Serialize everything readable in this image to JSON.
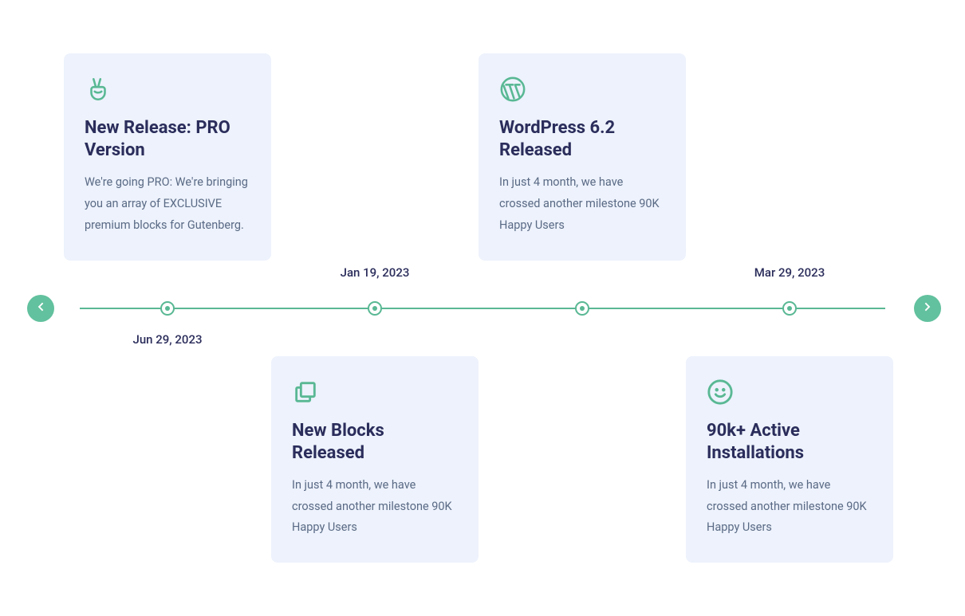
{
  "colors": {
    "accent": "#59b894",
    "arrow_bg": "#62c19e",
    "card_bg": "#edf2fc",
    "heading": "#2b2d5b",
    "body_text": "#5a6a85"
  },
  "timeline": {
    "nav_prev_label": "Previous",
    "nav_next_label": "Next",
    "items": [
      {
        "position": "top",
        "icon": "peace-hand-icon",
        "title": "New Release: PRO Version",
        "description": "We're going PRO: We're bringing you an array of EXCLUSIVE premium blocks for Gutenberg.",
        "date": "Jun 29, 2023",
        "date_side": "below"
      },
      {
        "position": "bottom",
        "icon": "copy-icon",
        "title": "New Blocks Released",
        "description": "In just 4 month, we have crossed another milestone 90K Happy Users",
        "date": "Jan 19, 2023",
        "date_side": "above"
      },
      {
        "position": "top",
        "icon": "wordpress-icon",
        "title": "WordPress 6.2 Released",
        "description": "In just 4 month, we have crossed another milestone 90K Happy Users",
        "date": "",
        "date_side": ""
      },
      {
        "position": "bottom",
        "icon": "smiley-icon",
        "title": "90k+ Active Installations",
        "description": "In just 4 month, we have crossed another milestone 90K Happy Users",
        "date": "Mar 29, 2023",
        "date_side": "above"
      }
    ]
  }
}
